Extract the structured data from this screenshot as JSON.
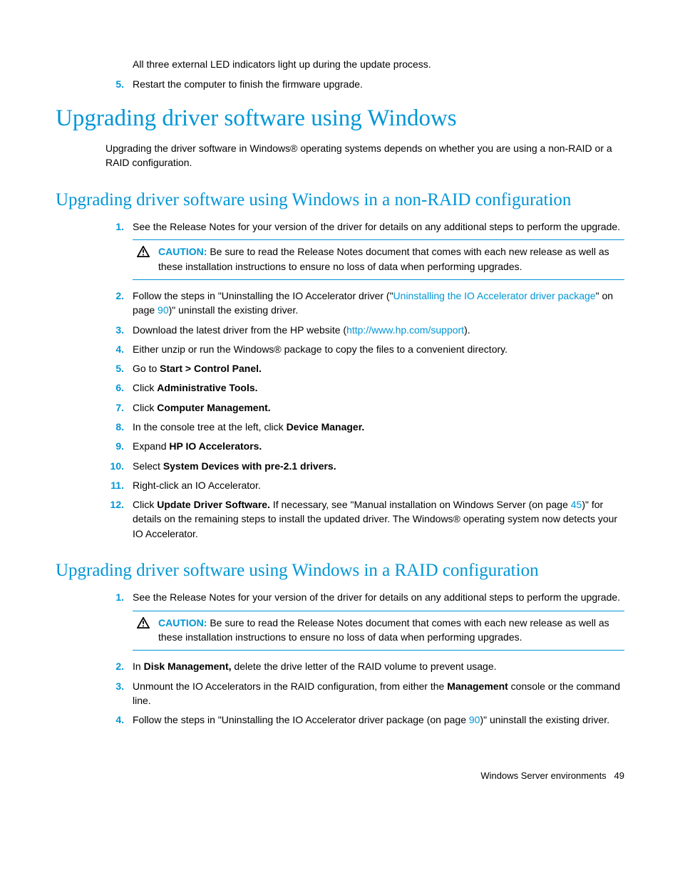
{
  "intro_led": "All three external LED indicators light up during the update process.",
  "intro_step5_num": "5.",
  "intro_step5_txt": "Restart the computer to finish the firmware upgrade.",
  "h1": "Upgrading driver software using Windows",
  "h1_intro": "Upgrading the driver software in Windows® operating systems depends on whether you are using a non-RAID or a RAID configuration.",
  "h2a": "Upgrading driver software using Windows in a non-RAID configuration",
  "secA": {
    "s1": {
      "num": "1.",
      "txt": "See the Release Notes for your version of the driver for details on any additional steps to perform the upgrade."
    },
    "caution_label": "CAUTION:",
    "caution_txt": "  Be sure to read the Release Notes document that comes with each new release as well as these installation instructions to ensure no loss of data when performing upgrades.",
    "s2": {
      "num": "2.",
      "pre": "Follow the steps in \"Uninstalling the IO Accelerator driver (\"",
      "link": "Uninstalling the IO Accelerator driver package",
      "mid": "\" on page ",
      "page": "90",
      "post": ")\" uninstall the existing driver."
    },
    "s3": {
      "num": "3.",
      "pre": "Download the latest driver from the HP website (",
      "link": "http://www.hp.com/support",
      "post": ")."
    },
    "s4": {
      "num": "4.",
      "txt": "Either unzip or run the Windows® package to copy the files to a convenient directory."
    },
    "s5": {
      "num": "5.",
      "pre": "Go to ",
      "bold": "Start > Control Panel."
    },
    "s6": {
      "num": "6.",
      "pre": "Click ",
      "bold": "Administrative Tools."
    },
    "s7": {
      "num": "7.",
      "pre": "Click ",
      "bold": "Computer Management."
    },
    "s8": {
      "num": "8.",
      "pre": "In the console tree at the left, click ",
      "bold": "Device Manager."
    },
    "s9": {
      "num": "9.",
      "pre": "Expand ",
      "bold": "HP IO Accelerators."
    },
    "s10": {
      "num": "10.",
      "pre": "Select ",
      "bold": "System Devices with pre-2.1 drivers."
    },
    "s11": {
      "num": "11.",
      "txt": "Right-click an IO Accelerator."
    },
    "s12": {
      "num": "12.",
      "pre": "Click ",
      "bold": "Update Driver Software.",
      "mid": " If necessary, see \"Manual installation on Windows Server (on page ",
      "page": "45",
      "post": ")\" for details on the remaining steps to install the updated driver. The Windows® operating system now detects your IO Accelerator."
    }
  },
  "h2b": "Upgrading driver software using Windows in a RAID configuration",
  "secB": {
    "s1": {
      "num": "1.",
      "txt": "See the Release Notes for your version of the driver for details on any additional steps to perform the upgrade."
    },
    "caution_label": "CAUTION:",
    "caution_txt": "  Be sure to read the Release Notes document that comes with each new release as well as these installation instructions to ensure no loss of data when performing upgrades.",
    "s2": {
      "num": "2.",
      "pre": "In ",
      "bold": "Disk Management,",
      "post": " delete the drive letter of the RAID volume to prevent usage."
    },
    "s3": {
      "num": "3.",
      "pre": "Unmount the IO Accelerators in the RAID configuration, from either the ",
      "bold": "Management",
      "post": " console or the command line."
    },
    "s4": {
      "num": "4.",
      "pre": "Follow the steps in \"Uninstalling the IO Accelerator driver package (on page ",
      "page": "90",
      "post": ")\" uninstall the existing driver."
    }
  },
  "footer_label": "Windows Server environments",
  "footer_page": "49"
}
